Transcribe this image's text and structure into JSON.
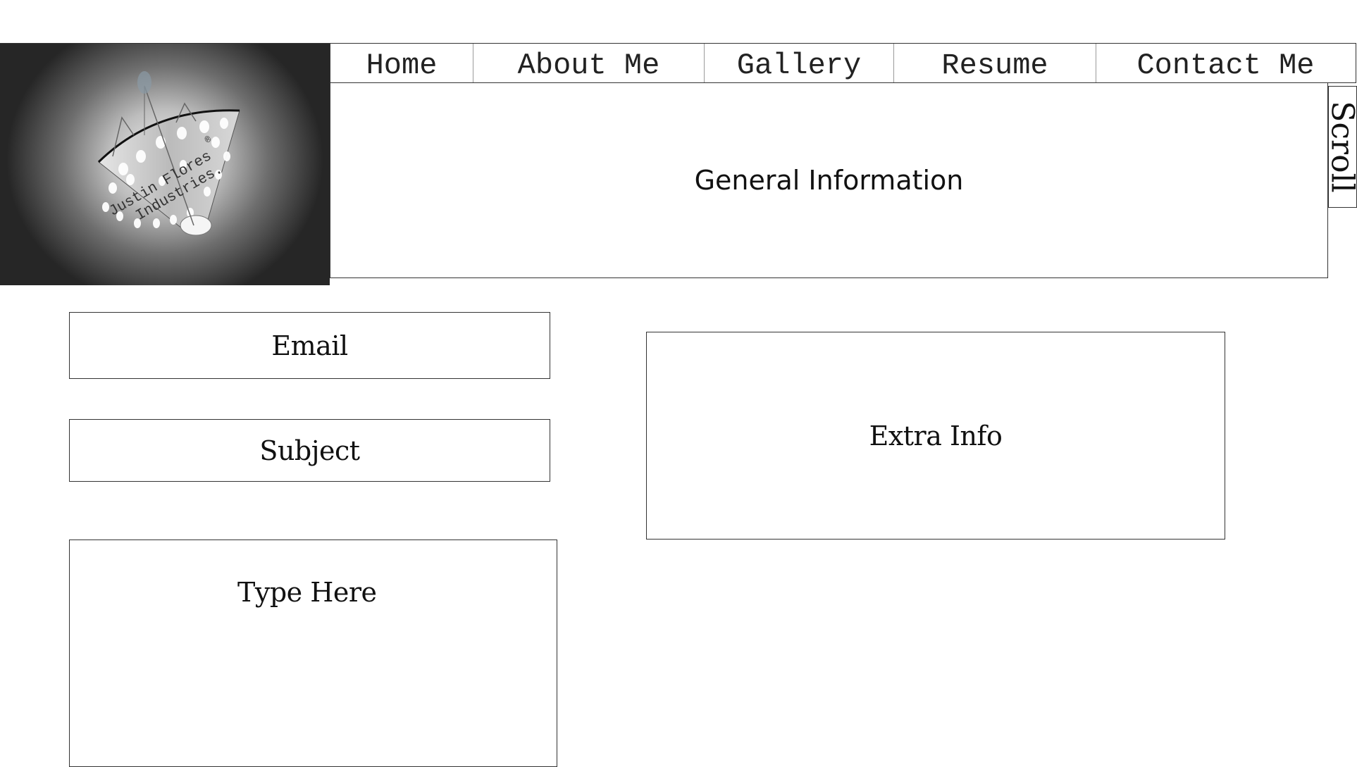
{
  "logo": {
    "text_line1": "Justin Flores",
    "text_line2": "Industries.",
    "registered_mark": "®"
  },
  "nav": {
    "items": [
      {
        "label": "Home"
      },
      {
        "label": "About Me"
      },
      {
        "label": "Gallery"
      },
      {
        "label": "Resume"
      },
      {
        "label": "Contact Me"
      }
    ]
  },
  "main": {
    "general_info": "General Information",
    "scroll_label": "Scroll"
  },
  "form": {
    "email_label": "Email",
    "subject_label": "Subject",
    "message_label": "Type Here",
    "extra_label": "Extra Info"
  }
}
